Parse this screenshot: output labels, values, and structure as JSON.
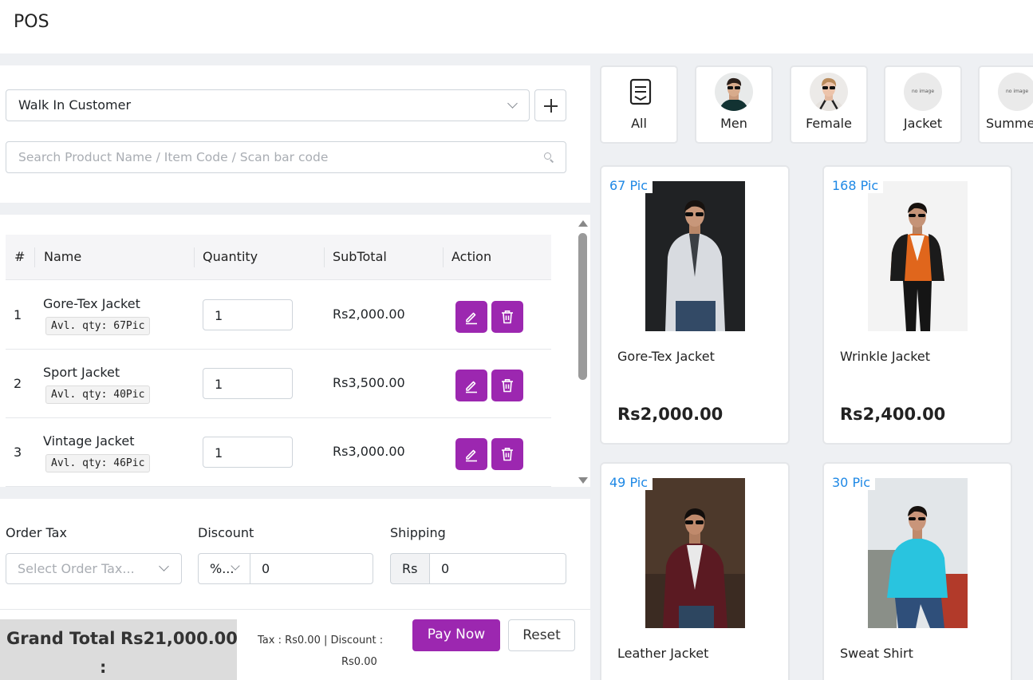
{
  "app": {
    "title": "POS"
  },
  "customer": {
    "selected": "Walk In Customer"
  },
  "search": {
    "placeholder": "Search Product Name / Item Code / Scan bar code"
  },
  "table": {
    "headers": [
      "#",
      "Name",
      "Quantity",
      "SubTotal",
      "Action"
    ],
    "rows": [
      {
        "index": "1",
        "name": "Gore-Tex Jacket",
        "available": "Avl. qty: 67Pic",
        "quantity": "1",
        "subtotal": "Rs2,000.00"
      },
      {
        "index": "2",
        "name": "Sport Jacket",
        "available": "Avl. qty: 40Pic",
        "quantity": "1",
        "subtotal": "Rs3,500.00"
      },
      {
        "index": "3",
        "name": "Vintage Jacket",
        "available": "Avl. qty: 46Pic",
        "quantity": "1",
        "subtotal": "Rs3,000.00"
      }
    ]
  },
  "order": {
    "tax_label": "Order Tax",
    "tax_placeholder": "Select Order Tax...",
    "discount_label": "Discount",
    "discount_type": "%...",
    "discount_value": "0",
    "shipping_label": "Shipping",
    "shipping_prefix": "Rs",
    "shipping_value": "0"
  },
  "totals": {
    "grand_label": "Grand Total",
    "grand_colon": ":",
    "grand_value": "Rs21,000.00",
    "summary_line1": "Tax : Rs0.00 | Discount :",
    "summary_line2": "Rs0.00"
  },
  "actions": {
    "pay": "Pay Now",
    "reset": "Reset"
  },
  "categories": [
    {
      "label": "All",
      "icon": "list-icon"
    },
    {
      "label": "Men",
      "icon": "men-avatar"
    },
    {
      "label": "Female",
      "icon": "female-avatar"
    },
    {
      "label": "Jacket",
      "icon": "no-image"
    },
    {
      "label": "Summer",
      "icon": "no-image"
    }
  ],
  "placeholder_image_text": "no image",
  "products": [
    {
      "stock": "67 Pic",
      "name": "Gore-Tex Jacket",
      "price": "Rs2,000.00"
    },
    {
      "stock": "168 Pic",
      "name": "Wrinkle Jacket",
      "price": "Rs2,400.00"
    },
    {
      "stock": "49 Pic",
      "name": "Leather Jacket",
      "price": ""
    },
    {
      "stock": "30 Pic",
      "name": "Sweat Shirt",
      "price": ""
    }
  ],
  "colors": {
    "accent": "#9c27b0",
    "stock_text": "#1e88e5",
    "background": "#eef0f3"
  }
}
